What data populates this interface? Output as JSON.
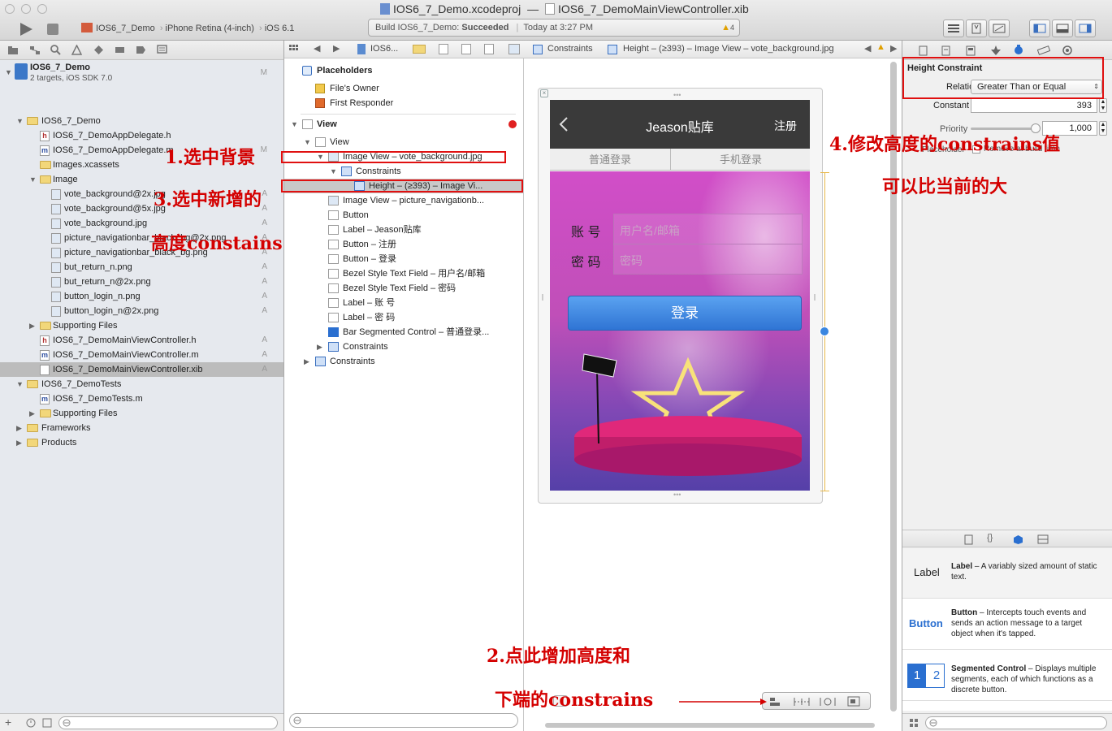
{
  "window": {
    "title_project": "IOS6_7_Demo.xcodeproj",
    "title_sep": "—",
    "title_file": "IOS6_7_DemoMainViewController.xib"
  },
  "toolbar": {
    "scheme": "IOS6_7_Demo",
    "device": "iPhone Retina (4-inch)",
    "sdk": "iOS 6.1",
    "status_prefix": "Build IOS6_7_Demo: ",
    "status_result": "Succeeded",
    "status_sep": "|",
    "status_time": "Today at 3:27 PM",
    "warnings": "4"
  },
  "navigator": {
    "project_name": "IOS6_7_Demo",
    "project_sub": "2 targets, iOS SDK 7.0",
    "project_badge": "M",
    "items": [
      {
        "label": "IOS6_7_Demo",
        "badge": ""
      },
      {
        "label": "IOS6_7_DemoAppDelegate.h",
        "badge": ""
      },
      {
        "label": "IOS6_7_DemoAppDelegate.m",
        "badge": "M"
      },
      {
        "label": "Images.xcassets",
        "badge": ""
      },
      {
        "label": "Image",
        "badge": ""
      },
      {
        "label": "vote_background@2x.jpg",
        "badge": "A"
      },
      {
        "label": "vote_background@5x.jpg",
        "badge": "A"
      },
      {
        "label": "vote_background.jpg",
        "badge": "A"
      },
      {
        "label": "picture_navigationbar_black_bg@2x.png",
        "badge": "A"
      },
      {
        "label": "picture_navigationbar_black_bg.png",
        "badge": "A"
      },
      {
        "label": "but_return_n.png",
        "badge": "A"
      },
      {
        "label": "but_return_n@2x.png",
        "badge": "A"
      },
      {
        "label": "button_login_n.png",
        "badge": "A"
      },
      {
        "label": "button_login_n@2x.png",
        "badge": "A"
      },
      {
        "label": "Supporting Files",
        "badge": ""
      },
      {
        "label": "IOS6_7_DemoMainViewController.h",
        "badge": "A"
      },
      {
        "label": "IOS6_7_DemoMainViewController.m",
        "badge": "A"
      },
      {
        "label": "IOS6_7_DemoMainViewController.xib",
        "badge": "A"
      },
      {
        "label": "IOS6_7_DemoTests",
        "badge": ""
      },
      {
        "label": "IOS6_7_DemoTests.m",
        "badge": ""
      },
      {
        "label": "Supporting Files",
        "badge": ""
      },
      {
        "label": "Frameworks",
        "badge": ""
      },
      {
        "label": "Products",
        "badge": ""
      }
    ]
  },
  "jumpbar": {
    "root": "IOS6...",
    "constraints": "Constraints",
    "current": "Height – (≥393) – Image View – vote_background.jpg"
  },
  "outline": {
    "placeholders": "Placeholders",
    "files_owner": "File's Owner",
    "first_responder": "First Responder",
    "view_section": "View",
    "view": "View",
    "image_view_bg": "Image View – vote_background.jpg",
    "constraints_inner": "Constraints",
    "height_constraint": "Height – (≥393) – Image Vi...",
    "items": [
      "Image View – picture_navigationb...",
      "Button",
      "Label – Jeason贴库",
      "Button – 注册",
      "Button – 登录",
      "Bezel Style Text Field – 用户名/邮箱",
      "Bezel Style Text Field – 密码",
      "Label – 账 号",
      "Label – 密 码",
      "Bar Segmented Control – 普通登录..."
    ],
    "constraints_view": "Constraints",
    "constraints_root": "Constraints"
  },
  "phone": {
    "nav_title": "Jeason贴库",
    "register": "注册",
    "segment_1": "普通登录",
    "segment_2": "手机登录",
    "account_label": "账 号",
    "account_placeholder": "用户名/邮箱",
    "password_label": "密 码",
    "password_placeholder": "密码",
    "login_button": "登录"
  },
  "inspector": {
    "section_title": "Height Constraint",
    "relation_label": "Relation",
    "relation_value": "Greater Than or Equal",
    "constant_label": "Constant",
    "constant_value": "393",
    "priority_label": "Priority",
    "priority_value": "1,000",
    "priority_level": 1.0,
    "placeholder_label": "Placeholder",
    "remove_label": "Remove at build time"
  },
  "library": [
    {
      "icon_text": "Label",
      "name": "Label",
      "desc": " – A variably sized amount of static text."
    },
    {
      "icon_text": "Button",
      "name": "Button",
      "desc": " – Intercepts touch events and sends an action message to a target object when it's tapped."
    },
    {
      "icon_text": "1 2",
      "name": "Segmented Control",
      "desc": " – Displays multiple segments, each of which functions as a discrete button."
    }
  ],
  "annotations": {
    "step1": "1.选中背景",
    "step2a": "2.点此增加高度和",
    "step2b": "下端的constrains",
    "step3a": "3.选中新增的",
    "step3b": "高度constains",
    "step4a": "4.修改高度的constrains值",
    "step4b": "可以比当前的大"
  },
  "colors": {
    "annotation_red": "#d40000",
    "selection_gray": "#bcbcbc",
    "login_blue": "#3b86e0",
    "phone_bg_pink": "#c44fb8"
  }
}
